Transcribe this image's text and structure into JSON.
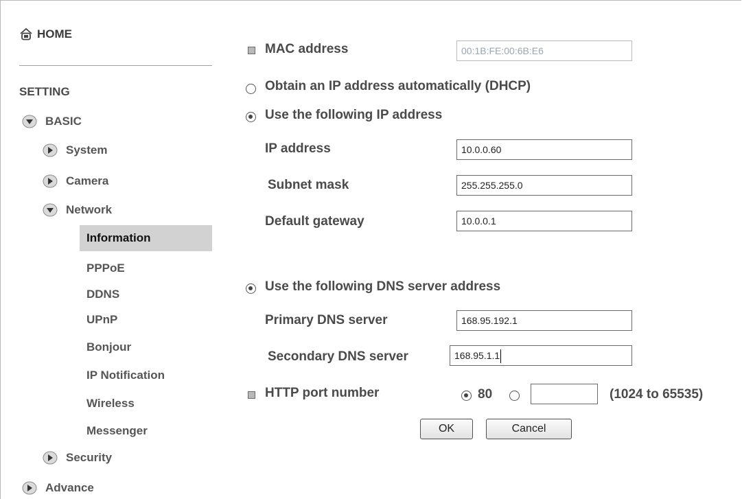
{
  "sidebar": {
    "home_label": "HOME",
    "setting_label": "SETTING",
    "basic_label": "BASIC",
    "system_label": "System",
    "camera_label": "Camera",
    "network_label": "Network",
    "network_items": [
      "Information",
      "PPPoE",
      "DDNS",
      "UPnP",
      "Bonjour",
      "IP Notification",
      "Wireless",
      "Messenger"
    ],
    "active_item": "Information",
    "security_label": "Security",
    "advance_label": "Advance"
  },
  "form": {
    "mac_label": "MAC address",
    "mac_value": "00:1B:FE:00:6B:E6",
    "dhcp_label": "Obtain an IP address automatically (DHCP)",
    "dhcp_selected": false,
    "static_label": "Use the following IP address",
    "static_selected": true,
    "ip_label": "IP address",
    "ip_value": "10.0.0.60",
    "subnet_label": "Subnet mask",
    "subnet_value": "255.255.255.0",
    "gateway_label": "Default gateway",
    "gateway_value": "10.0.0.1",
    "dns_option_label": "Use the following DNS server address",
    "dns_option_selected": true,
    "primary_dns_label": "Primary DNS server",
    "primary_dns_value": "168.95.192.1",
    "secondary_dns_label": "Secondary DNS server",
    "secondary_dns_value": "168.95.1.1",
    "http_port_label": "HTTP port number",
    "http_port_default": "80",
    "http_port_default_selected": true,
    "http_port_custom_value": "",
    "http_port_range": "(1024 to 65535)",
    "ok_label": "OK",
    "cancel_label": "Cancel"
  },
  "colors": {
    "active_bg": "#d2d2d2",
    "text": "#4a4a4a"
  },
  "icons": {
    "home": "home-icon",
    "expanded": "triangle-down-icon",
    "collapsed": "triangle-right-icon"
  }
}
